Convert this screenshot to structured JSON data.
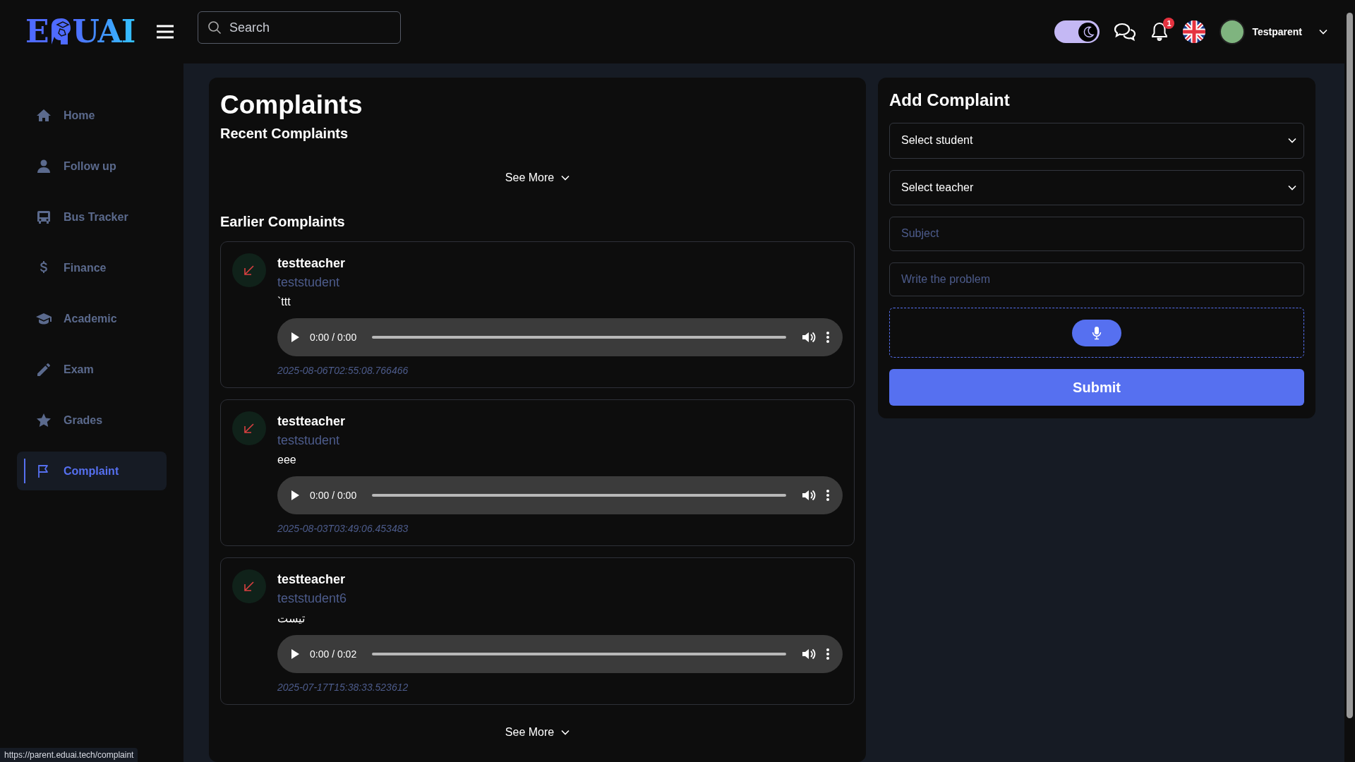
{
  "logo": {
    "left": "E",
    "right": "UAI"
  },
  "search": {
    "placeholder": "Search"
  },
  "header": {
    "dark_mode": true,
    "notification_count": "1",
    "user": "Testparent"
  },
  "sidebar": {
    "items": [
      {
        "label": "Home",
        "selected": false
      },
      {
        "label": "Follow up",
        "selected": false
      },
      {
        "label": "Bus Tracker",
        "selected": false
      },
      {
        "label": "Finance",
        "selected": false
      },
      {
        "label": "Academic",
        "selected": false
      },
      {
        "label": "Exam",
        "selected": false
      },
      {
        "label": "Grades",
        "selected": false
      },
      {
        "label": "Complaint",
        "selected": true
      }
    ]
  },
  "page": {
    "title": "Complaints",
    "recent_heading": "Recent Complaints",
    "see_more_top": "See More",
    "earlier_heading": "Earlier Complaints",
    "see_more_bottom": "See More"
  },
  "complaints": [
    {
      "teacher": "testteacher",
      "student": "teststudent",
      "message": "`ttt",
      "audio_time": "0:00 / 0:00",
      "timestamp": "2025-08-06T02:55:08.766466"
    },
    {
      "teacher": "testteacher",
      "student": "teststudent",
      "message": "eee",
      "audio_time": "0:00 / 0:00",
      "timestamp": "2025-08-03T03:49:06.453483"
    },
    {
      "teacher": "testteacher",
      "student": "teststudent6",
      "message": "تيست",
      "audio_time": "0:00 / 0:02",
      "timestamp": "2025-07-17T15:38:33.523612"
    }
  ],
  "form": {
    "title": "Add Complaint",
    "student_select": "Select student",
    "teacher_select": "Select teacher",
    "subject_placeholder": "Subject",
    "problem_placeholder": "Write the problem",
    "submit": "Submit"
  },
  "status_url": "https://parent.eduai.tech/complaint"
}
